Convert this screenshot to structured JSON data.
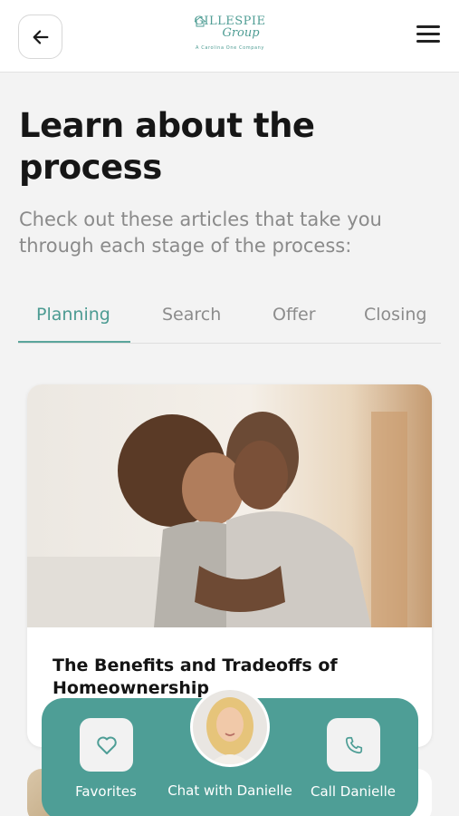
{
  "header": {
    "back_icon": "arrow-left-icon",
    "logo": {
      "mark": "GILLESPIE",
      "script": "Group",
      "tagline": "A Carolina One Company"
    },
    "menu_icon": "hamburger-menu-icon"
  },
  "page": {
    "title": "Learn about the process",
    "subtitle": "Check out these articles that take you through each stage of the process:"
  },
  "tabs": [
    {
      "label": "Planning",
      "active": true
    },
    {
      "label": "Search",
      "active": false
    },
    {
      "label": "Offer",
      "active": false
    },
    {
      "label": "Closing",
      "active": false
    }
  ],
  "articles": [
    {
      "title": "The Benefits and Tradeoffs of Homeownership",
      "image": "father-hugging-daughter-photo"
    }
  ],
  "bottom_bar": {
    "favorites": {
      "label": "Favorites",
      "icon": "heart-icon"
    },
    "chat": {
      "label": "Chat with Danielle",
      "icon": "agent-avatar"
    },
    "call": {
      "label": "Call Danielle",
      "icon": "phone-icon"
    }
  },
  "colors": {
    "accent": "#4e9e96",
    "tab_active": "#4c9b92",
    "muted_text": "#8a8a8a"
  }
}
